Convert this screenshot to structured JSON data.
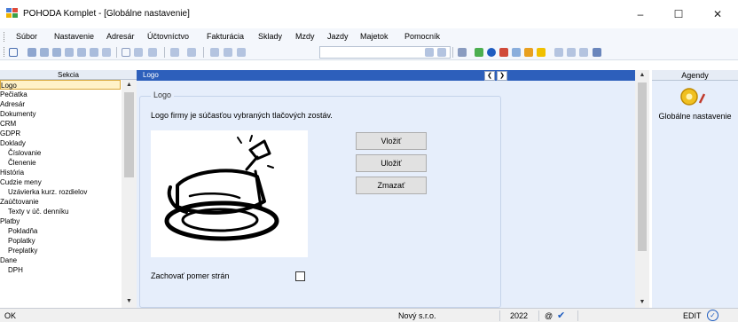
{
  "window": {
    "title": "POHODA Komplet - [Globálne nastavenie]",
    "controls": [
      "–",
      "☐",
      "✕"
    ]
  },
  "menu": [
    "Súbor",
    "Nastavenie",
    "Adresár",
    "Účtovníctvo",
    "Fakturácia",
    "Sklady",
    "Mzdy",
    "Jazdy",
    "Majetok",
    "Pomocník"
  ],
  "sekcia": {
    "title": "Sekcia",
    "items": [
      {
        "label": "Logo",
        "selected": true,
        "indent": 0
      },
      {
        "label": "Pečiatka",
        "indent": 0
      },
      {
        "label": "Adresár",
        "indent": 0
      },
      {
        "label": "Dokumenty",
        "indent": 0
      },
      {
        "label": "CRM",
        "indent": 0
      },
      {
        "label": "GDPR",
        "indent": 0
      },
      {
        "label": "Doklady",
        "indent": 0
      },
      {
        "label": "Číslovanie",
        "indent": 1
      },
      {
        "label": "Členenie",
        "indent": 1
      },
      {
        "label": "História",
        "indent": 0
      },
      {
        "label": "Cudzie meny",
        "indent": 0
      },
      {
        "label": "Uzávierka kurz. rozdielov",
        "indent": 1
      },
      {
        "label": "Zaúčtovanie",
        "indent": 0
      },
      {
        "label": "Texty v úč. denníku",
        "indent": 1
      },
      {
        "label": "Platby",
        "indent": 0
      },
      {
        "label": "Pokladňa",
        "indent": 1
      },
      {
        "label": "Poplatky",
        "indent": 1
      },
      {
        "label": "Preplatky",
        "indent": 1
      },
      {
        "label": "Dane",
        "indent": 0
      },
      {
        "label": "DPH",
        "indent": 1
      }
    ]
  },
  "center": {
    "header": "Logo",
    "group_title": "Logo",
    "description": "Logo firmy je súčasťou vybraných tlačových zostáv.",
    "buttons": {
      "insert": "Vložiť",
      "save": "Uložiť",
      "delete": "Zmazať"
    },
    "keep_ratio_label": "Zachovať pomer strán",
    "keep_ratio_checked": false
  },
  "agendy": {
    "title": "Agendy",
    "item_label": "Globálne nastavenie"
  },
  "status": {
    "left": "OK",
    "company": "Nový s.r.o.",
    "year": "2022",
    "at": "@",
    "mode": "EDIT"
  },
  "colors": {
    "header_blue": "#2d5fbb",
    "panel_bg": "#e6eefb",
    "selection": "#fff2c8"
  }
}
